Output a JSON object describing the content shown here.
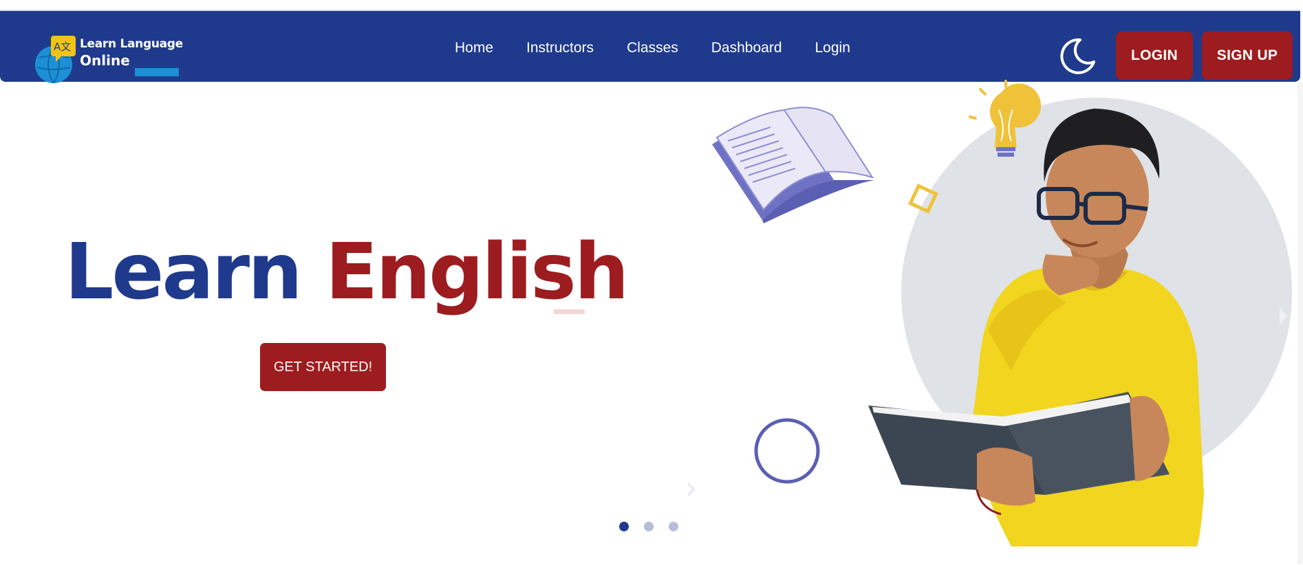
{
  "brand": {
    "line1": "Learn Language",
    "line2": "Online",
    "icon_glyph": "A文"
  },
  "nav": {
    "items": [
      "Home",
      "Instructors",
      "Classes",
      "Dashboard",
      "Login"
    ]
  },
  "header": {
    "theme_icon": "moon-icon",
    "login_label": "LOGIN",
    "signup_label": "SIGN UP"
  },
  "hero": {
    "word1": "Learn",
    "word2": "English",
    "cta_label": "GET STARTED!"
  },
  "carousel": {
    "slides": 3,
    "active_index": 0
  },
  "colors": {
    "navy": "#1f3a8c",
    "red": "#9d1c1f",
    "yellow": "#f2d51f",
    "circle_gray": "#dfe2e6",
    "purple": "#5b5fb3"
  }
}
